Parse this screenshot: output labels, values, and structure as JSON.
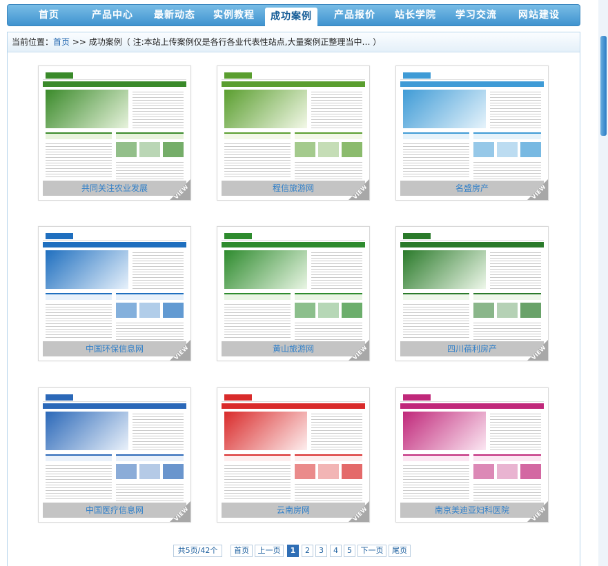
{
  "nav": {
    "items": [
      {
        "label": "首页"
      },
      {
        "label": "产品中心"
      },
      {
        "label": "最新动态"
      },
      {
        "label": "实例教程"
      },
      {
        "label": "成功案例",
        "active": true
      },
      {
        "label": "产品报价"
      },
      {
        "label": "站长学院"
      },
      {
        "label": "学习交流"
      },
      {
        "label": "网站建设"
      }
    ]
  },
  "breadcrumb": {
    "prefix": "当前位置：",
    "home": "首页",
    "separator": " >> ",
    "current": "成功案例",
    "note": "（ 注:本站上传案例仅是各行各业代表性站点,大量案例正整理当中… ）"
  },
  "cases": [
    {
      "title": "共同关注农业发展",
      "theme": "#3a8a2a",
      "accent": "#e8f3dd"
    },
    {
      "title": "程信旅游网",
      "theme": "#5a9e2f",
      "accent": "#f3f8e8"
    },
    {
      "title": "名盛房产",
      "theme": "#3f9bd6",
      "accent": "#e6f3fb"
    },
    {
      "title": "中国环保信息网",
      "theme": "#1f6fbf",
      "accent": "#e7f1fb"
    },
    {
      "title": "黄山旅游网",
      "theme": "#2e8b2e",
      "accent": "#e9f5e4"
    },
    {
      "title": "四川蓓利房产",
      "theme": "#2a7a2a",
      "accent": "#eef7ea"
    },
    {
      "title": "中国医疗信息网",
      "theme": "#2b68b8",
      "accent": "#eaf1fa"
    },
    {
      "title": "云南房网",
      "theme": "#d92b2b",
      "accent": "#fdeeee"
    },
    {
      "title": "南京美迪亚妇科医院",
      "theme": "#c0287a",
      "accent": "#fbe7f2"
    }
  ],
  "card_badge": "VIEW",
  "pagination": {
    "summary": "共5页/42个",
    "first": "首页",
    "prev": "上一页",
    "pages": [
      "1",
      "2",
      "3",
      "4",
      "5"
    ],
    "current_page": "1",
    "next": "下一页",
    "last": "尾页"
  }
}
